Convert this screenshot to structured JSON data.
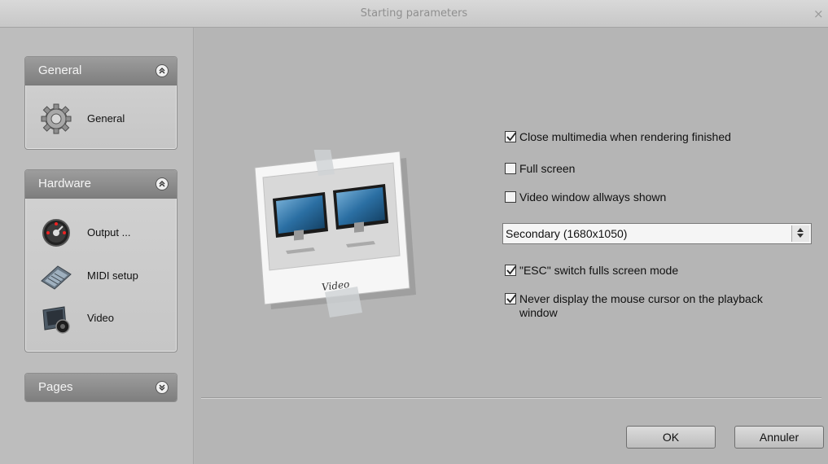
{
  "window": {
    "title": "Starting parameters",
    "close_icon": "×"
  },
  "sidebar": {
    "groups": [
      {
        "title": "General",
        "collapse_icon": "chevrons-up-icon",
        "items": [
          {
            "label": "General",
            "icon": "gear-icon"
          }
        ]
      },
      {
        "title": "Hardware",
        "collapse_icon": "chevrons-up-icon",
        "items": [
          {
            "label": "Output ...",
            "icon": "output-dial-icon"
          },
          {
            "label": "MIDI setup",
            "icon": "midi-keyboard-icon"
          },
          {
            "label": "Video",
            "icon": "video-camera-icon"
          }
        ]
      },
      {
        "title": "Pages",
        "collapse_icon": "chevrons-down-icon",
        "items": []
      }
    ]
  },
  "main": {
    "illustration": {
      "caption": "Video",
      "icon": "dual-monitor-photo-icon"
    },
    "options": [
      {
        "label": "Close multimedia when rendering finished",
        "checked": true
      },
      {
        "label": "Full screen",
        "checked": false
      },
      {
        "label": "Video window allways shown",
        "checked": false
      },
      {
        "label": "\"ESC\" switch fulls screen mode",
        "checked": true
      },
      {
        "label": "Never display the mouse cursor on the playback",
        "label_line2": "window",
        "checked": true
      }
    ],
    "display_select": {
      "value": "Secondary (1680x1050)"
    }
  },
  "buttons": {
    "ok": "OK",
    "cancel": "Annuler"
  },
  "colors": {
    "window_bg": "#b7b7b7",
    "group_header": "#8a8a8a",
    "title_text": "#8f8f8f"
  }
}
